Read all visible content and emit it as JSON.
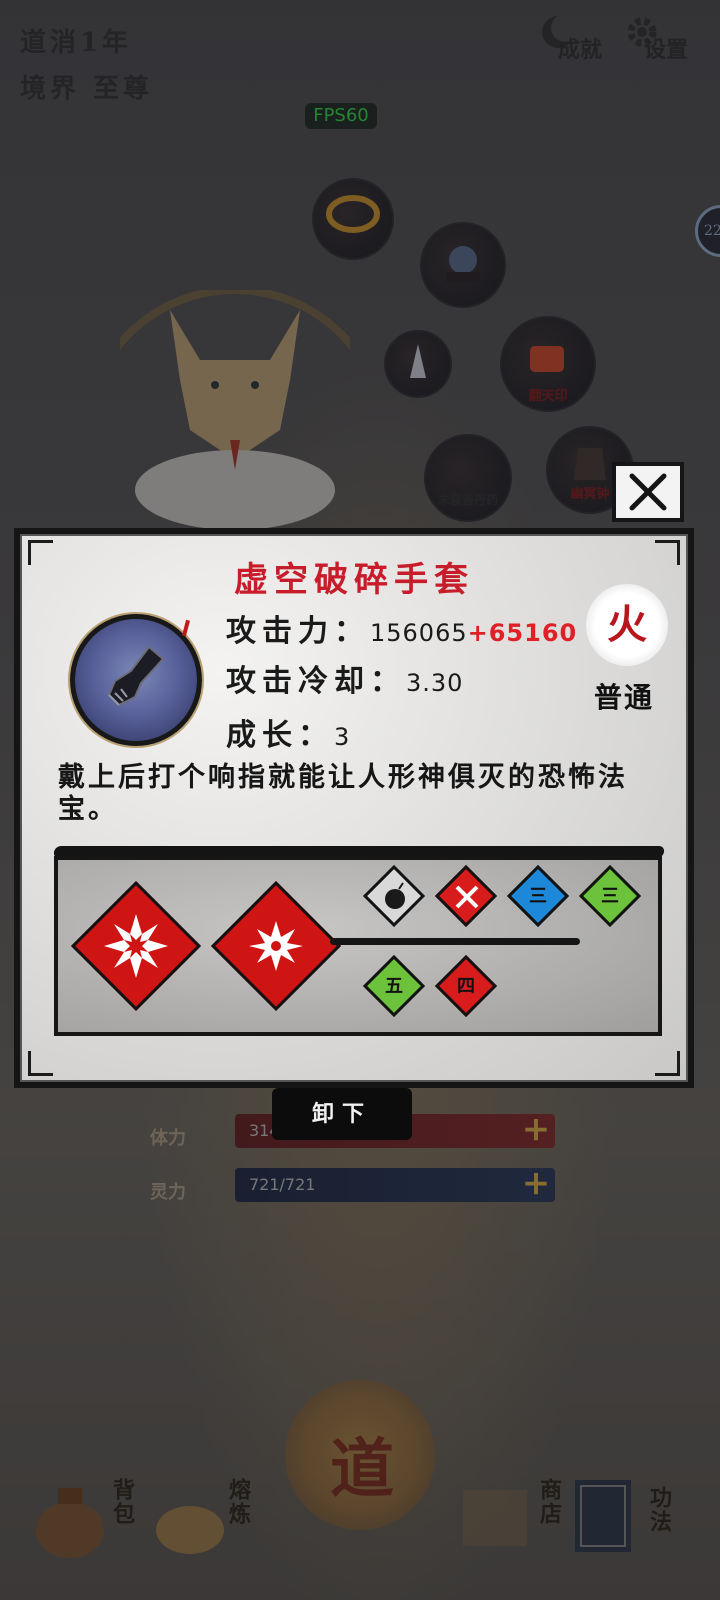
{
  "header": {
    "years": "道消1年",
    "realm": "境界 至尊",
    "achievements": "成就",
    "settings": "设置",
    "fps": "FPS60",
    "side_badge": "22"
  },
  "equipment_slots": [
    {
      "label": "翻天印"
    },
    {
      "label": "未装备丹药"
    },
    {
      "label": "幽冥钟"
    }
  ],
  "stats": {
    "stamina_label": "体力",
    "stamina_value": "314",
    "spirit_label": "灵力",
    "spirit_value": "721/721"
  },
  "unequip_label": "卸下",
  "bottom_nav": [
    {
      "label": "背包"
    },
    {
      "label": "熔炼"
    },
    {
      "label": "商店"
    },
    {
      "label": "功法"
    }
  ],
  "center_emblem": "道",
  "item_detail": {
    "name": "虚空破碎手套",
    "attack_label": "攻击力：",
    "attack_value": "156065",
    "attack_bonus": "+65160",
    "cooldown_label": "攻击冷却：",
    "cooldown_value": "3.30",
    "growth_label": "成长：",
    "growth_value": "3",
    "element": "火",
    "quality": "普通",
    "description": "戴上后打个响指就能让人形神俱灭的恐怖法宝。",
    "mini_badges": {
      "three_a": "三",
      "three_b": "三",
      "five": "五",
      "four": "四"
    }
  },
  "colors": {
    "title_red": "#c81c2b",
    "bonus_red": "#e01f26",
    "skill_red": "#cf1414",
    "fps_green": "#34e04a"
  }
}
